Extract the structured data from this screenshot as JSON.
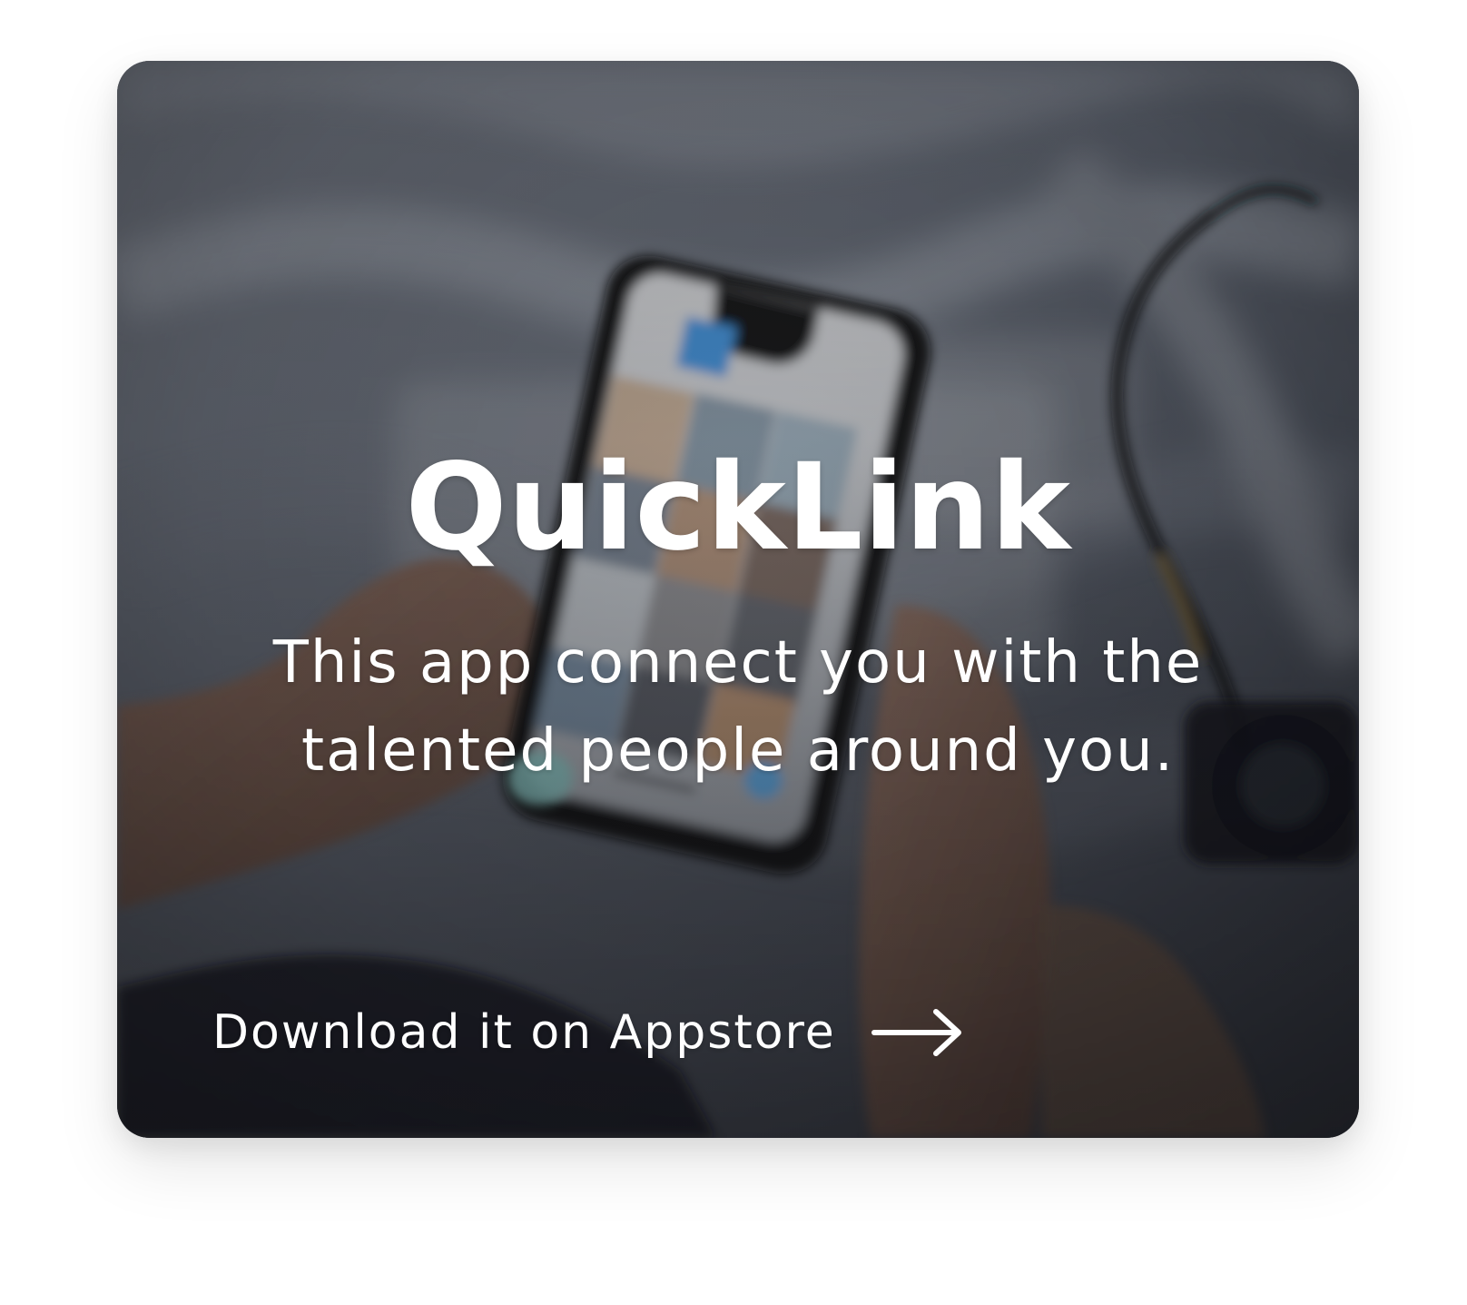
{
  "card": {
    "title": "QuickLink",
    "subtitle": "This app connect you with the talented people around you.",
    "cta": {
      "label": "Download it on Appstore",
      "icon": "right-arrow-icon"
    }
  },
  "theme": {
    "text_color": "#ffffff",
    "card_background": "#3f434b",
    "accent": "#5ba8e2"
  }
}
